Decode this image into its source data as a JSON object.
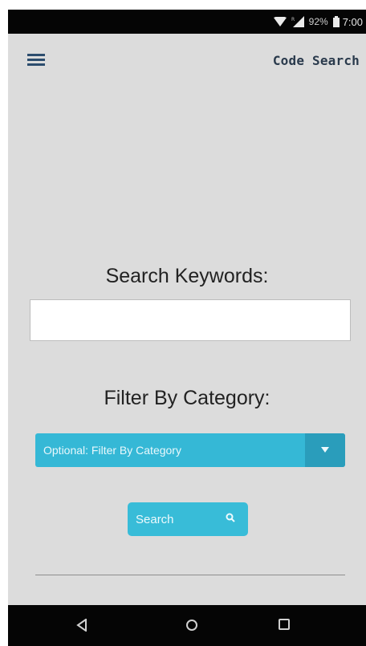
{
  "status_bar": {
    "battery_percent": "92%",
    "time": "7:00",
    "icons": [
      "wifi-icon",
      "signal-icon",
      "battery-icon"
    ]
  },
  "header": {
    "menu_icon": "hamburger-menu-icon",
    "title": "Code Search"
  },
  "form": {
    "keywords_label": "Search Keywords:",
    "keywords_value": "",
    "category_label": "Filter By Category:",
    "category_select": {
      "selected": "Optional: Filter By Category",
      "arrow_icon": "triangle-down-icon"
    },
    "search_button": {
      "label": "Search",
      "icon": "magnifier-icon"
    }
  },
  "nav_bar": {
    "buttons": [
      "back-icon",
      "home-icon",
      "recents-icon"
    ]
  },
  "colors": {
    "background": "#dcdcdc",
    "accent": "#38bcd8",
    "accent_dark": "#2a9dbb",
    "title": "#2a3a4c"
  }
}
